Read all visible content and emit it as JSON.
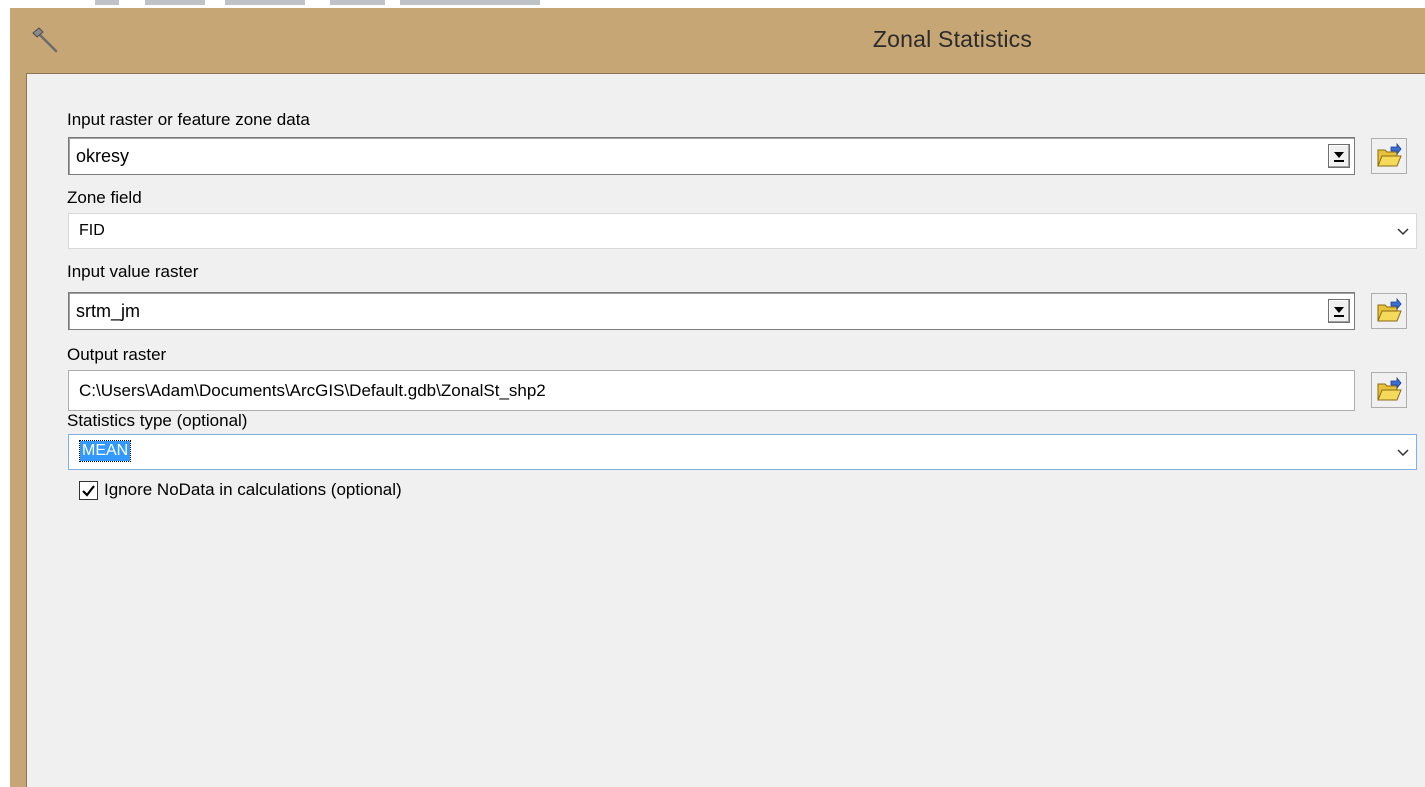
{
  "window": {
    "title": "Zonal Statistics",
    "title_icon": "hammer-icon"
  },
  "colors": {
    "titlebar": "#c6a675",
    "client_background": "#f0f0f0",
    "selection": "#3399ff",
    "focus_border": "#7fb0e3"
  },
  "form": {
    "input_zone": {
      "label": "Input raster or feature zone data",
      "value": "okresy",
      "browse_icon": "open-folder-icon"
    },
    "zone_field": {
      "label": "Zone field",
      "value": "FID"
    },
    "input_value_raster": {
      "label": "Input value raster",
      "value": "srtm_jm",
      "browse_icon": "open-folder-icon"
    },
    "output_raster": {
      "label": "Output raster",
      "value": "C:\\Users\\Adam\\Documents\\ArcGIS\\Default.gdb\\ZonalSt_shp2",
      "browse_icon": "open-folder-icon"
    },
    "statistics_type": {
      "label": "Statistics type (optional)",
      "value": "MEAN"
    },
    "ignore_nodata": {
      "label": "Ignore NoData in calculations (optional)",
      "checked": true
    }
  }
}
